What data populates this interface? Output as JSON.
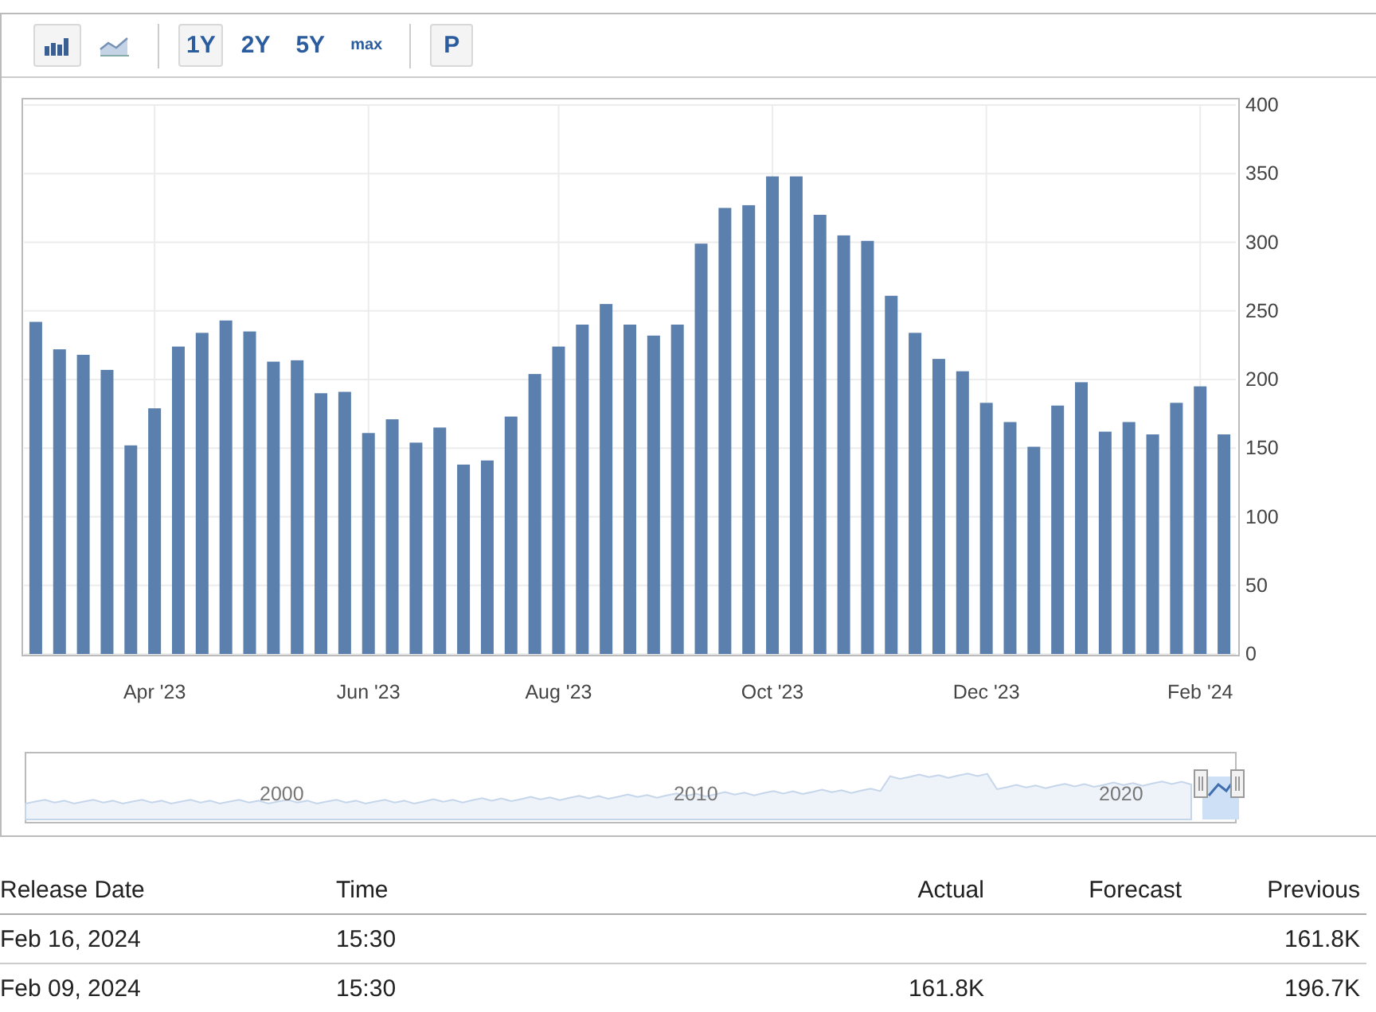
{
  "toolbar": {
    "chart_types": [
      {
        "kind": "bar",
        "selected": true
      },
      {
        "kind": "line",
        "selected": false
      }
    ],
    "ranges": [
      {
        "label": "1Y",
        "selected": true
      },
      {
        "label": "2Y",
        "selected": false
      },
      {
        "label": "5Y",
        "selected": false
      },
      {
        "label": "max",
        "selected": false
      }
    ],
    "extra": [
      {
        "label": "P",
        "selected": true
      }
    ]
  },
  "chart": {
    "chart_data": {
      "type": "bar",
      "categories": [
        null,
        null,
        null,
        null,
        null,
        "Apr '23",
        null,
        null,
        null,
        null,
        null,
        null,
        null,
        null,
        "Jun '23",
        null,
        null,
        null,
        null,
        null,
        null,
        null,
        "Aug '23",
        null,
        null,
        null,
        null,
        null,
        null,
        null,
        null,
        "Oct '23",
        null,
        null,
        null,
        null,
        null,
        null,
        null,
        null,
        "Dec '23",
        null,
        null,
        null,
        null,
        null,
        null,
        null,
        null,
        "Feb '24",
        null
      ],
      "series": [
        {
          "color": "#5b80ad",
          "values": [
            242,
            222,
            218,
            207,
            152,
            179,
            224,
            234,
            243,
            235,
            213,
            214,
            190,
            191,
            161,
            171,
            154,
            165,
            138,
            141,
            173,
            204,
            224,
            240,
            255,
            240,
            232,
            240,
            299,
            325,
            327,
            348,
            348,
            320,
            305,
            301,
            261,
            234,
            215,
            206,
            183,
            169,
            151,
            181,
            198,
            162,
            169,
            160,
            183,
            195,
            160
          ]
        }
      ],
      "grid": true,
      "ylim": [
        0,
        400
      ],
      "yticks": [
        0,
        50,
        100,
        150,
        200,
        250,
        300,
        350,
        400
      ]
    }
  },
  "navigator": {
    "labels": [
      "2000",
      "2010",
      "2020"
    ]
  },
  "table": {
    "columns": [
      "Release Date",
      "Time",
      "Actual",
      "Forecast",
      "Previous"
    ],
    "rows": [
      [
        "Feb 16, 2024",
        "15:30",
        "",
        "",
        "161.8K"
      ],
      [
        "Feb 09, 2024",
        "15:30",
        "161.8K",
        "",
        "196.7K"
      ]
    ]
  }
}
